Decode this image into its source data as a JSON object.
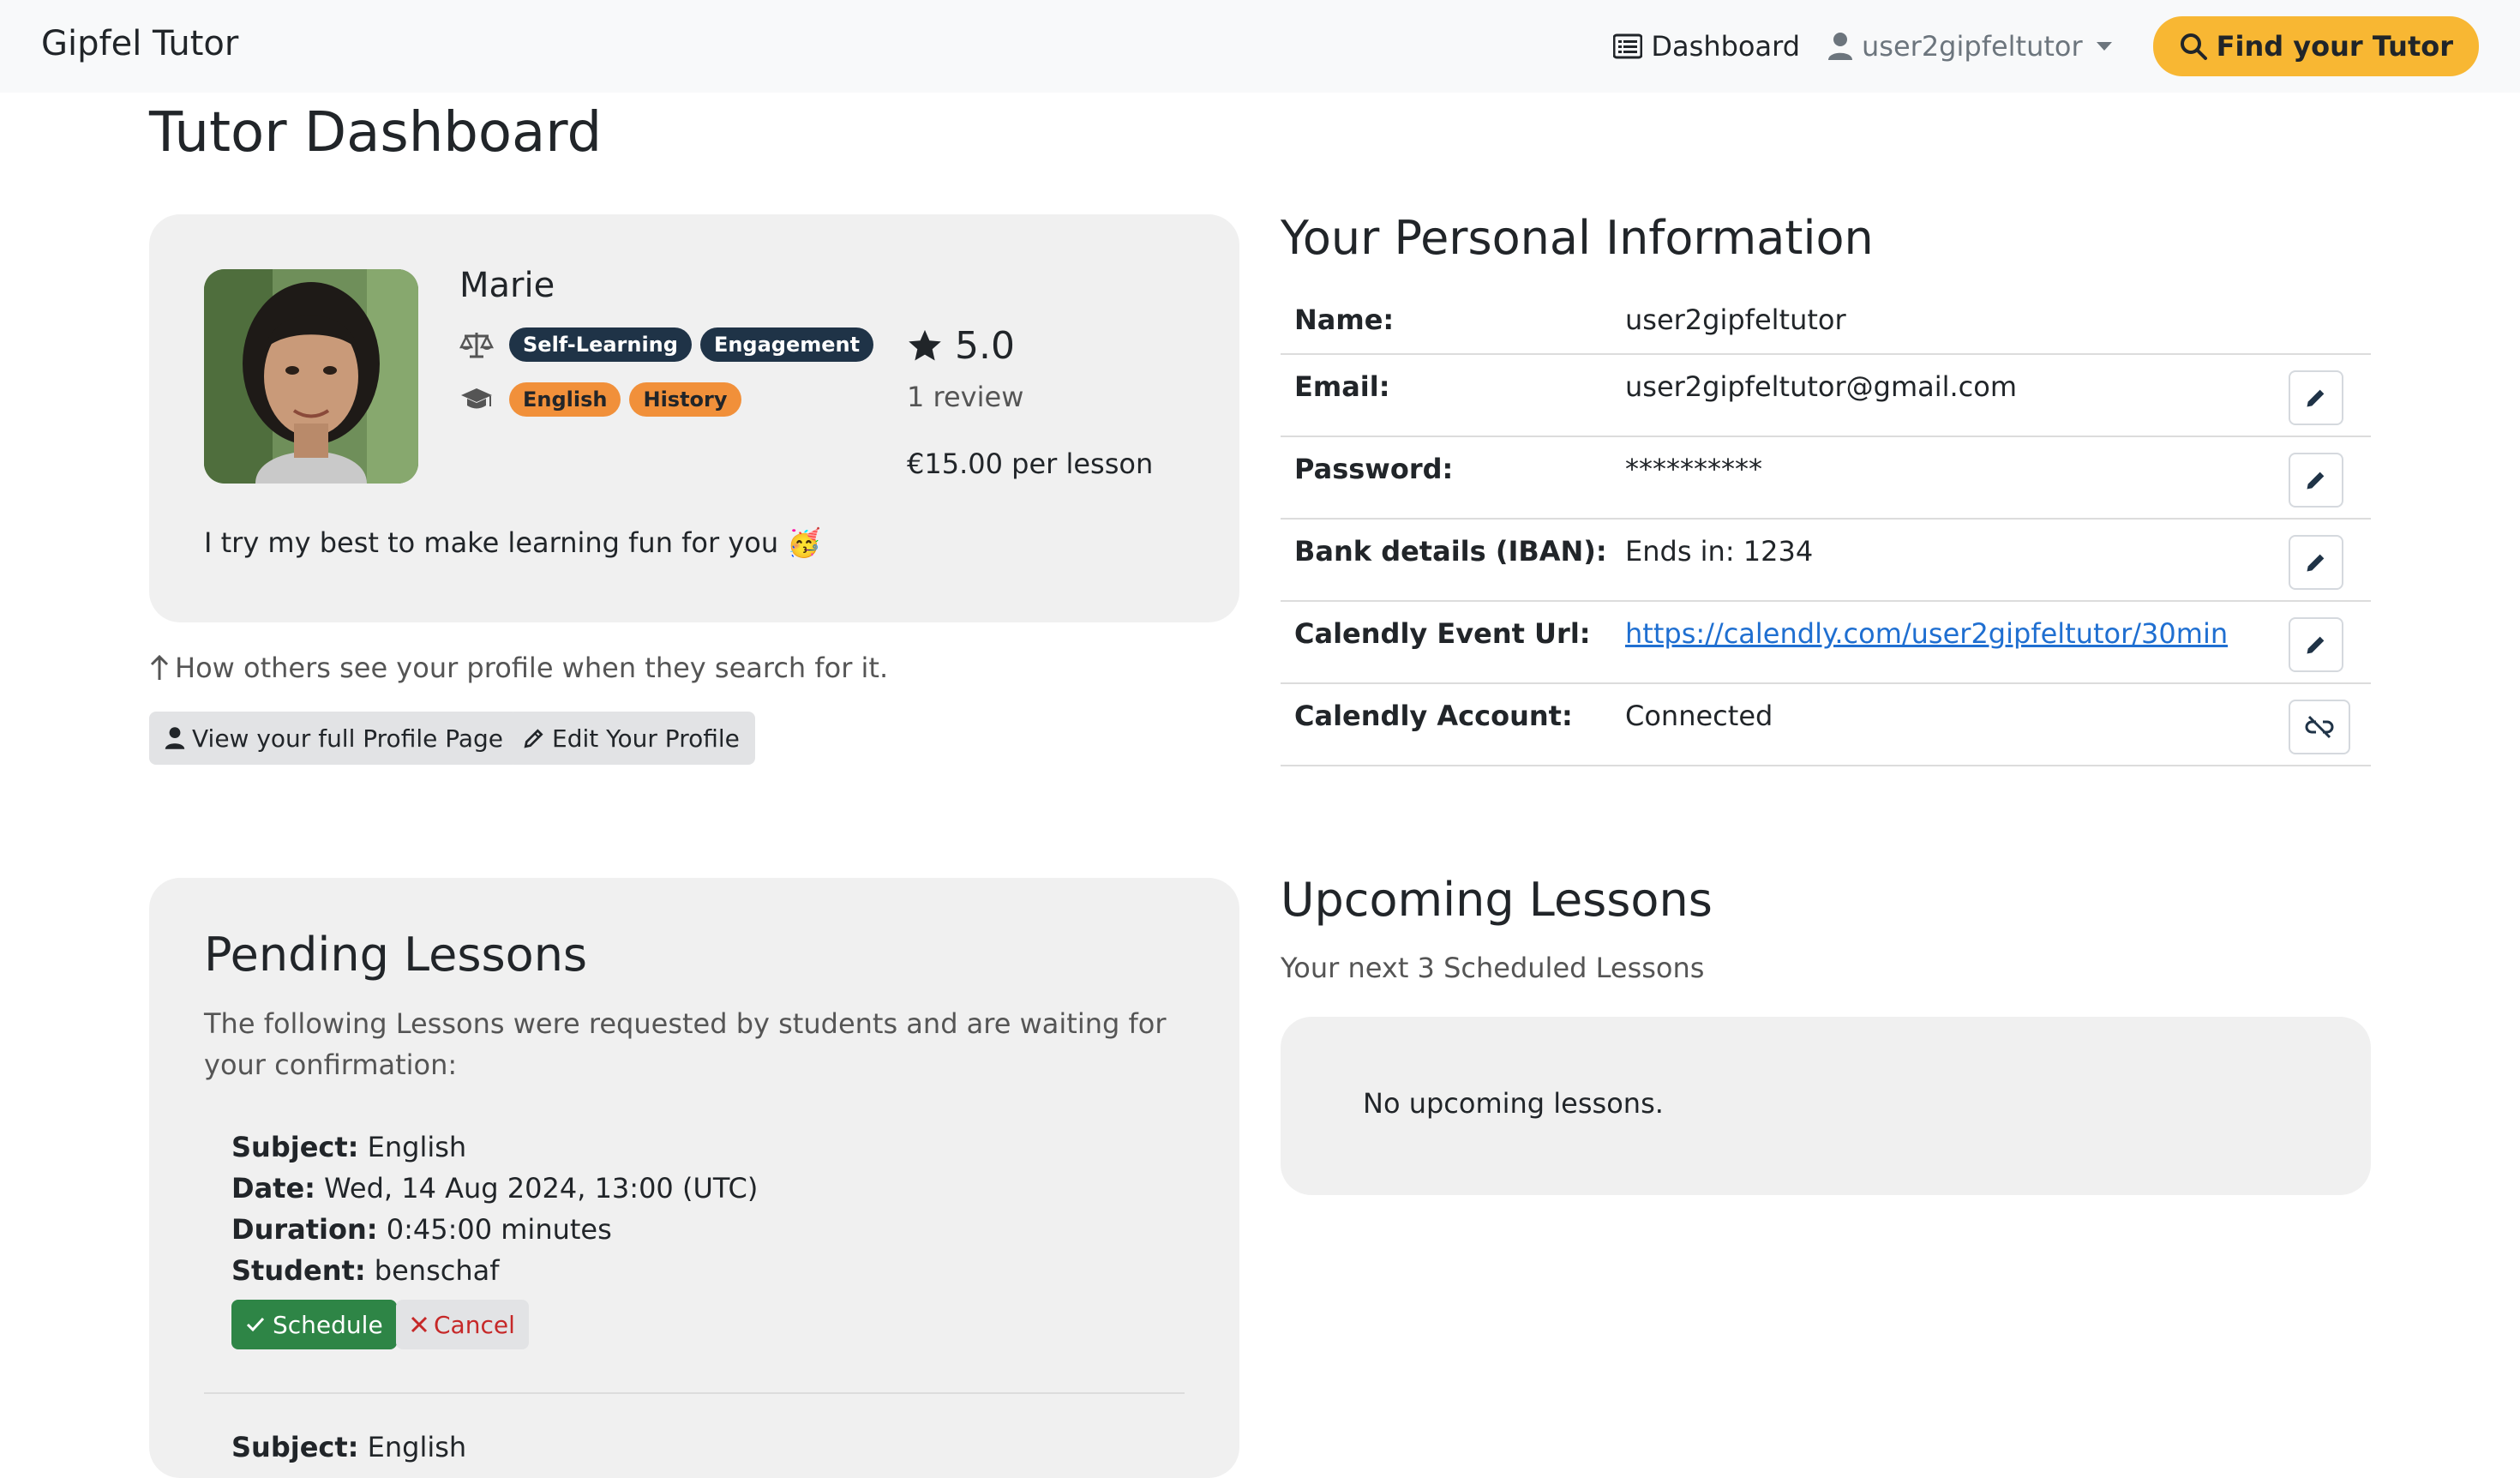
{
  "nav": {
    "brand": "Gipfel Tutor",
    "dashboard_label": "Dashboard",
    "user_label": "user2gipfeltutor",
    "find_label": "Find your Tutor"
  },
  "page_title": "Tutor Dashboard",
  "profile": {
    "name": "Marie",
    "topics": [
      "Self-Learning",
      "Engagement"
    ],
    "subjects": [
      "English",
      "History"
    ],
    "rating": "5.0",
    "reviews": "1 review",
    "price": "€15.00 per lesson",
    "bio": "I try my best to make learning fun for you 🥳"
  },
  "profile_hint": "How others see your profile when they search for it.",
  "buttons": {
    "view_profile": "View your full Profile Page",
    "edit_profile": "Edit Your Profile"
  },
  "personal_info": {
    "title": "Your Personal Information",
    "rows": [
      {
        "label": "Name:",
        "value": "user2gipfeltutor"
      },
      {
        "label": "Email:",
        "value": "user2gipfeltutor@gmail.com"
      },
      {
        "label": "Password:",
        "value": "**********"
      },
      {
        "label": "Bank details (IBAN):",
        "value": "Ends in: 1234"
      },
      {
        "label": "Calendly Event Url:",
        "value": "https://calendly.com/user2gipfeltutor/30min"
      },
      {
        "label": "Calendly Account:",
        "value": "Connected"
      }
    ]
  },
  "pending": {
    "title": "Pending Lessons",
    "description": "The following Lessons were requested by students and are waiting for your confirmation:",
    "lesson": {
      "subject_label": "Subject:",
      "subject": "English",
      "date_label": "Date:",
      "date": "Wed, 14 Aug 2024, 13:00 (UTC)",
      "duration_label": "Duration:",
      "duration": "0:45:00 minutes",
      "student_label": "Student:",
      "student": "benschaf"
    },
    "schedule_label": "Schedule",
    "cancel_label": "Cancel",
    "next_lesson": {
      "subject_label": "Subject:",
      "subject": "English"
    }
  },
  "upcoming": {
    "title": "Upcoming Lessons",
    "subtitle": "Your next 3 Scheduled Lessons",
    "empty": "No upcoming lessons."
  },
  "colors": {
    "accent": "#f8b733",
    "badge_dark": "#1f3347",
    "badge_orange": "#f1903a",
    "schedule_green": "#2e8546",
    "cancel_red": "#c62828"
  }
}
